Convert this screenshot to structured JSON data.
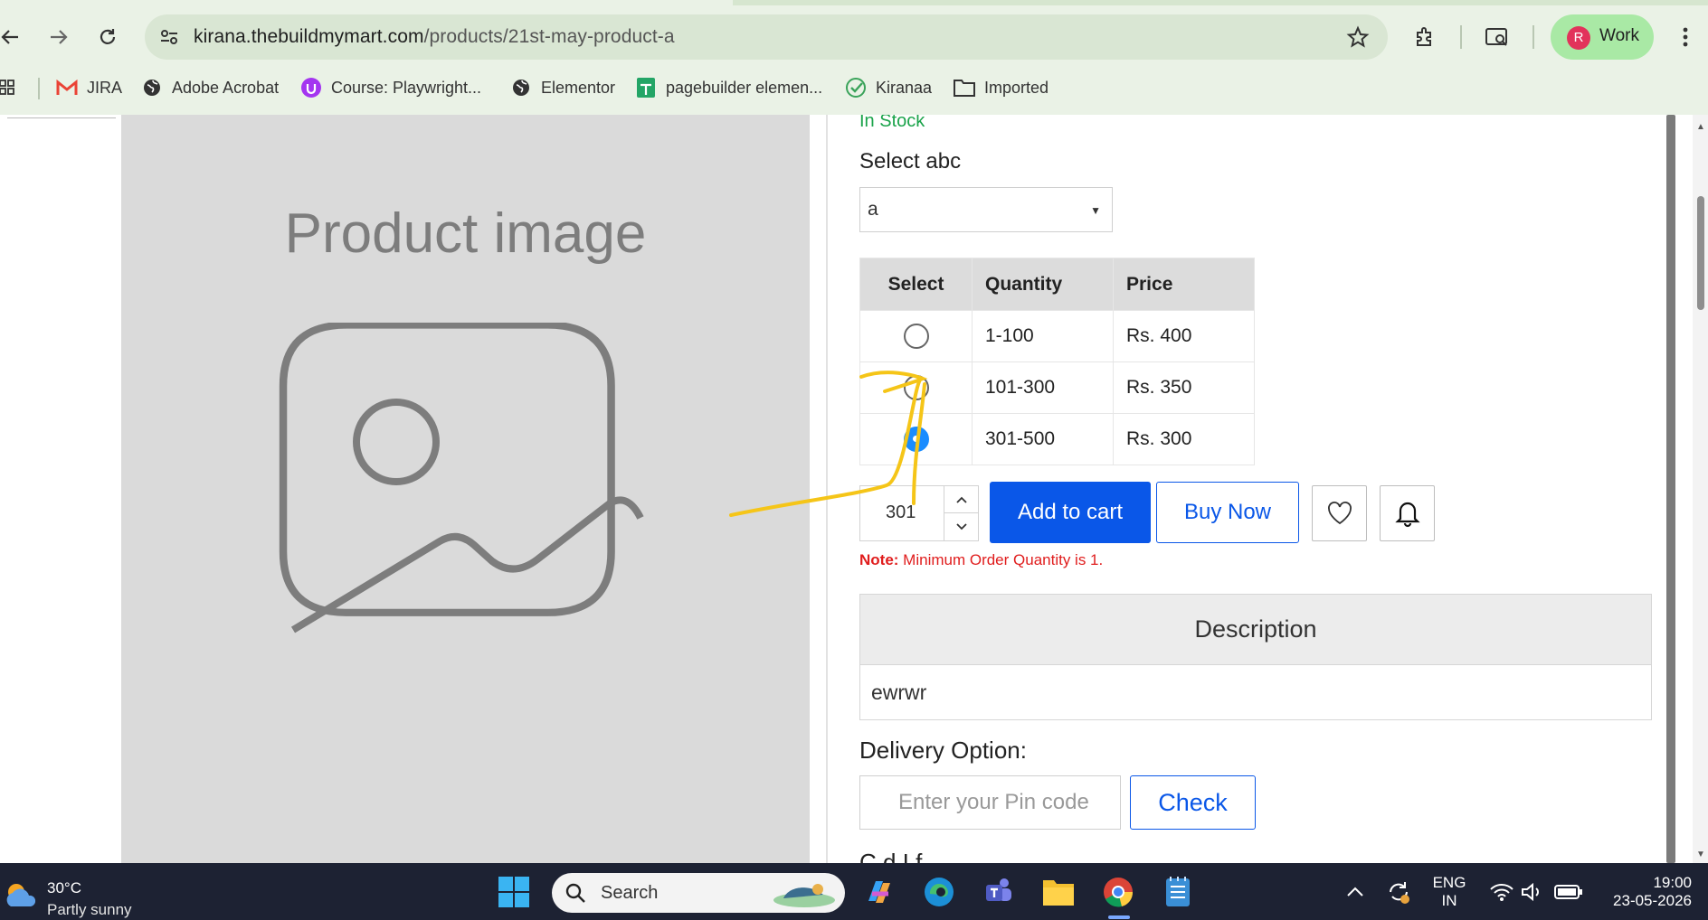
{
  "browser": {
    "url_host": "kirana.thebuildmymart.com",
    "url_path": "/products/21st-may-product-a",
    "profile_initial": "R",
    "profile_label": "Work"
  },
  "bookmarks": [
    {
      "label": "JIRA",
      "icon": "gmail-icon"
    },
    {
      "label": "Adobe Acrobat",
      "icon": "globe-icon"
    },
    {
      "label": "Course: Playwright...",
      "icon": "udemy-icon"
    },
    {
      "label": "Elementor",
      "icon": "globe-icon"
    },
    {
      "label": "pagebuilder elemen...",
      "icon": "sheets-icon"
    },
    {
      "label": "Kiranaa",
      "icon": "check-icon"
    },
    {
      "label": "Imported",
      "icon": "folder-icon"
    }
  ],
  "product": {
    "image_caption": "Product image",
    "stock": "In Stock",
    "select_label": "Select abc",
    "select_value": "a",
    "table_headers": [
      "Select",
      "Quantity",
      "Price"
    ],
    "tiers": [
      {
        "quantity": "1-100",
        "price": "Rs. 400",
        "selected": false
      },
      {
        "quantity": "101-300",
        "price": "Rs. 350",
        "selected": false
      },
      {
        "quantity": "301-500",
        "price": "Rs. 300",
        "selected": true
      }
    ],
    "quantity_value": "301",
    "add_to_cart": "Add to cart",
    "buy_now": "Buy Now",
    "note_label": "Note:",
    "note_text": " Minimum Order Quantity is 1.",
    "description_title": "Description",
    "description_body": "ewrwr",
    "delivery_label": "Delivery Option:",
    "pin_placeholder": "Enter your Pin code",
    "check_label": "Check",
    "cut_text": "C    d I  f"
  },
  "taskbar": {
    "temperature": "30°C",
    "weather": "Partly sunny",
    "search_label": "Search",
    "lang_top": "ENG",
    "lang_bottom": "IN",
    "time": "19:00",
    "date": "23-05-2026"
  },
  "colors": {
    "primary_button": "#0a57e8",
    "stock_green": "#1aa34a",
    "note_red": "#e01d1d",
    "radio_selected": "#1a8cff",
    "annotation": "#f5c518"
  }
}
